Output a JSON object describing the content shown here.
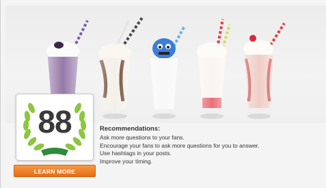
{
  "hero": {
    "image_subject": "milkshakes",
    "straw_colors": [
      "#7a5fa8",
      "#4a4a4a",
      "#6ab0de",
      "#e34040",
      "#e34040"
    ]
  },
  "score": {
    "value": "88",
    "laurel_color": "#8cc63f",
    "ribbon_color": "#2e8b3a"
  },
  "learn_more_button": {
    "label": "LEARN MORE",
    "color": "#f07d1e"
  },
  "recommendations": {
    "title": "Recommendations:",
    "items": [
      "Ask more questions to your fans.",
      "Encourage your fans to ask more questions for you to answer.",
      "Use hashtags in your posts.",
      "Improve your timing."
    ]
  }
}
